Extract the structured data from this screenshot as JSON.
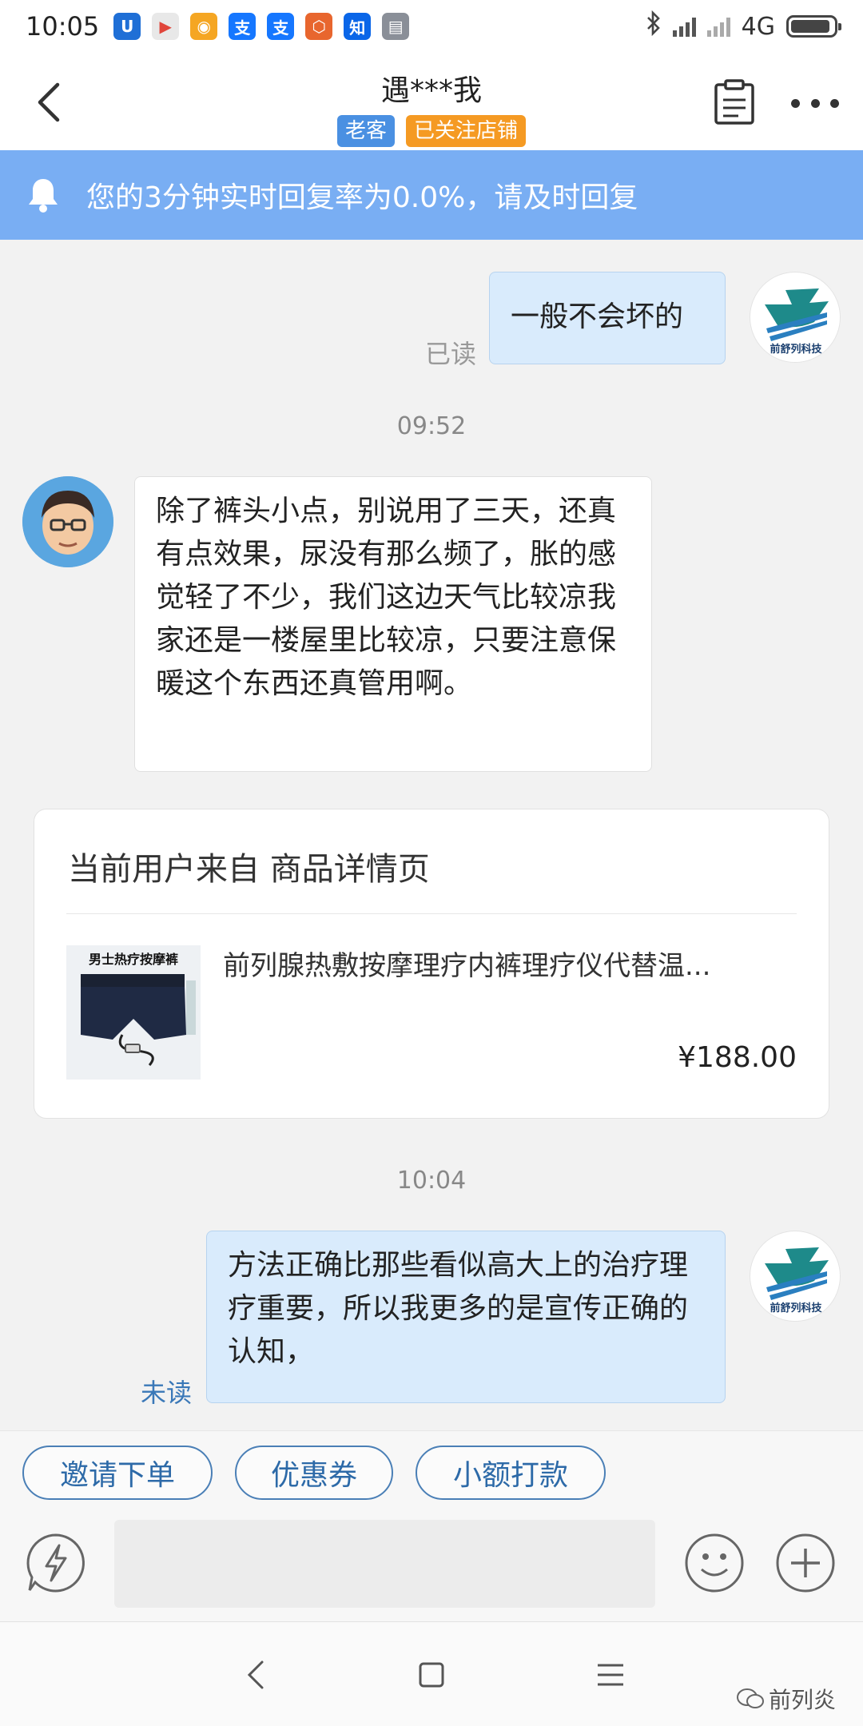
{
  "status_bar": {
    "time": "10:05",
    "network": "4G",
    "app_icons": [
      {
        "name": "u-app-icon",
        "glyph": "U",
        "color": "#1f6fd6"
      },
      {
        "name": "play-store-icon",
        "glyph": "▶",
        "color": "#e8e8e8"
      },
      {
        "name": "chat-app-icon",
        "glyph": "◉",
        "color": "#f5a623"
      },
      {
        "name": "alipay-icon",
        "glyph": "支",
        "color": "#1677ff"
      },
      {
        "name": "alipay-2-icon",
        "glyph": "支",
        "color": "#1677ff"
      },
      {
        "name": "shield-app-icon",
        "glyph": "⬡",
        "color": "#e8662e"
      },
      {
        "name": "zhihu-icon",
        "glyph": "知",
        "color": "#0a66e8"
      },
      {
        "name": "calculator-icon",
        "glyph": "▤",
        "color": "#8a8f98"
      }
    ]
  },
  "header": {
    "title": "遇***我",
    "tag_old_customer": "老客",
    "tag_followed": "已关注店铺"
  },
  "notice": {
    "text": "您的3分钟实时回复率为0.0%，请及时回复"
  },
  "messages": {
    "m1": {
      "text": "一般不会坏的",
      "status": "已读"
    },
    "time1": "09:52",
    "m2": {
      "text": "除了裤头小点，别说用了三天，还真有点效果，尿没有那么频了，胀的感觉轻了不少，我们这边天气比较凉我家还是一楼屋里比较凉，只要注意保暖这个东西还真管用啊。"
    },
    "product": {
      "title": "当前用户来自 商品详情页",
      "name": "前列腺热敷按摩理疗内裤理疗仪代替温...",
      "price": "¥188.00",
      "thumb_label": "男士热疗按摩裤"
    },
    "time2": "10:04",
    "m3": {
      "text": "方法正确比那些看似高大上的治疗理疗重要，所以我更多的是宣传正确的认知，",
      "status": "未读"
    }
  },
  "quick_actions": {
    "invite": "邀请下单",
    "coupon": "优惠券",
    "small_payment": "小额打款"
  },
  "watermark": "前列炎",
  "colors": {
    "accent": "#79aef3",
    "read": "#999999",
    "unread": "#3a78b8"
  }
}
